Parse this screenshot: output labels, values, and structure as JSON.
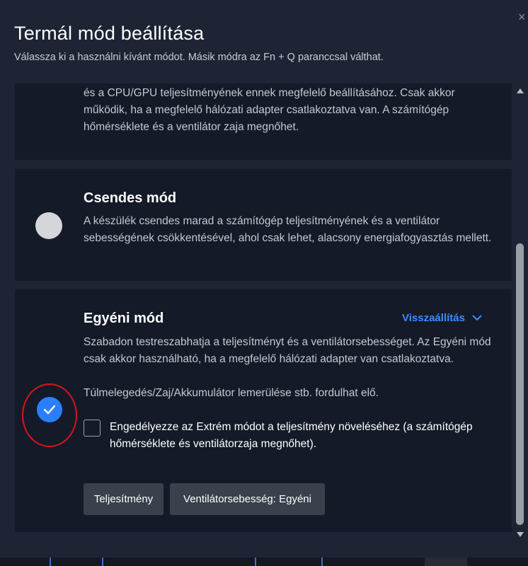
{
  "dialog": {
    "title": "Termál mód beállítása",
    "subtitle": "Válassza ki a használni kívánt módot. Másik módra az Fn + Q paranccsal válthat.",
    "close_icon": "close-icon"
  },
  "modes": {
    "top_partial": {
      "description": "és a CPU/GPU teljesítményének ennek megfelelő beállításához. Csak akkor működik, ha a megfelelő hálózati adapter csatlakoztatva van. A számítógép hőmérséklete és a ventilátor zaja megnőhet."
    },
    "quiet": {
      "title": "Csendes mód",
      "description": "A készülék csendes marad a számítógép teljesítményének és a ventilátor sebességének csökkentésével, ahol csak lehet, alacsony energiafogyasztás mellett.",
      "selected": false
    },
    "custom": {
      "title": "Egyéni mód",
      "reset_label": "Visszaállítás",
      "description": "Szabadon testreszabhatja a teljesítményt és a ventilátorsebességet. Az Egyéni mód csak akkor használható, ha a megfelelő hálózati adapter van csatlakoztatva.",
      "warning": "Túlmelegedés/Zaj/Akkumulátor lemerülése stb. fordulhat elő.",
      "extreme_checkbox_label": "Engedélyezze az Extrém módot a teljesítmény növeléséhez (a számítógép hőmérséklete és ventilátorzaja megnőhet).",
      "extreme_checked": false,
      "performance_button": "Teljesítmény",
      "fan_button": "Ventilátorsebesség: Egyéni",
      "selected": true
    }
  },
  "colors": {
    "accent": "#2a7fff",
    "link": "#3b8cff",
    "card_bg": "#141a28",
    "dialog_bg": "#1e2434",
    "annotation": "#d8141c"
  }
}
